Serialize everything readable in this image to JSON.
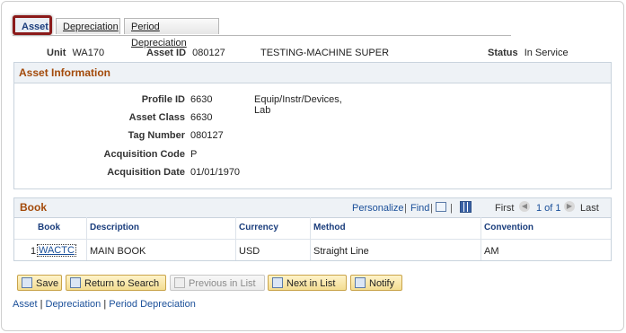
{
  "tabs": [
    "Asset",
    "Depreciation",
    "Period Depreciation"
  ],
  "header": {
    "unit_label": "Unit",
    "unit_value": "WA170",
    "asset_id_label": "Asset ID",
    "asset_id_value": "080127",
    "asset_desc": "TESTING-MACHINE SUPER",
    "status_label": "Status",
    "status_value": "In Service"
  },
  "asset_info": {
    "title": "Asset Information",
    "profile_id_label": "Profile ID",
    "profile_id_value": "6630",
    "profile_desc": "Equip/Instr/Devices, Lab",
    "asset_class_label": "Asset Class",
    "asset_class_value": "6630",
    "tag_number_label": "Tag Number",
    "tag_number_value": "080127",
    "acq_code_label": "Acquisition Code",
    "acq_code_value": "P",
    "acq_date_label": "Acquisition Date",
    "acq_date_value": "01/01/1970"
  },
  "book": {
    "title": "Book",
    "personalize": "Personalize",
    "find": "Find",
    "sep": "|",
    "first": "First",
    "page": "1 of 1",
    "last": "Last",
    "columns": [
      "Book",
      "Description",
      "Currency",
      "Method",
      "Convention"
    ],
    "row": {
      "num": "1",
      "book": "WACTC",
      "description": "MAIN BOOK",
      "currency": "USD",
      "method": "Straight Line",
      "convention": "AM"
    }
  },
  "buttons": {
    "save": "Save",
    "return": "Return to Search",
    "previous": "Previous in List",
    "next": "Next in List",
    "notify": "Notify"
  },
  "footer_links": {
    "asset": "Asset",
    "depreciation": "Depreciation",
    "period": "Period Depreciation",
    "sep": "|"
  }
}
